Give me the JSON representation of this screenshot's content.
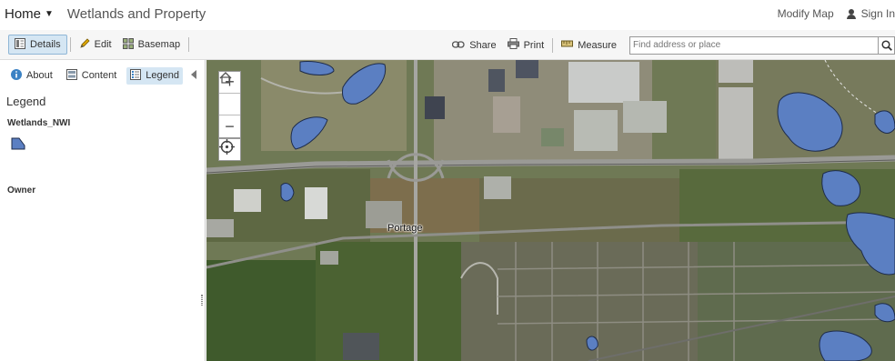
{
  "header": {
    "home_label": "Home",
    "map_title": "Wetlands and Property",
    "modify_label": "Modify Map",
    "signin_label": "Sign In"
  },
  "toolbar": {
    "details_label": "Details",
    "edit_label": "Edit",
    "basemap_label": "Basemap",
    "share_label": "Share",
    "print_label": "Print",
    "measure_label": "Measure",
    "search_placeholder": "Find address or place"
  },
  "panel": {
    "tabs": [
      {
        "label": "About",
        "icon": "info-icon"
      },
      {
        "label": "Content",
        "icon": "content-icon"
      },
      {
        "label": "Legend",
        "icon": "legend-icon",
        "active": true
      }
    ],
    "legend_title": "Legend",
    "layers": [
      {
        "name": "Wetlands_NWI",
        "symbol": "polygon",
        "fill": "#5b7fc2",
        "outline": "#1d2b4a"
      },
      {
        "name": "Owner"
      }
    ]
  },
  "map": {
    "place_label": "Portage",
    "wetland_fill": "#5b7fc2",
    "controls": [
      "zoom-in",
      "home",
      "zoom-out",
      "locate"
    ]
  },
  "colors": {
    "accent": "#d5e6f3",
    "accent_border": "#8fb6d6"
  }
}
